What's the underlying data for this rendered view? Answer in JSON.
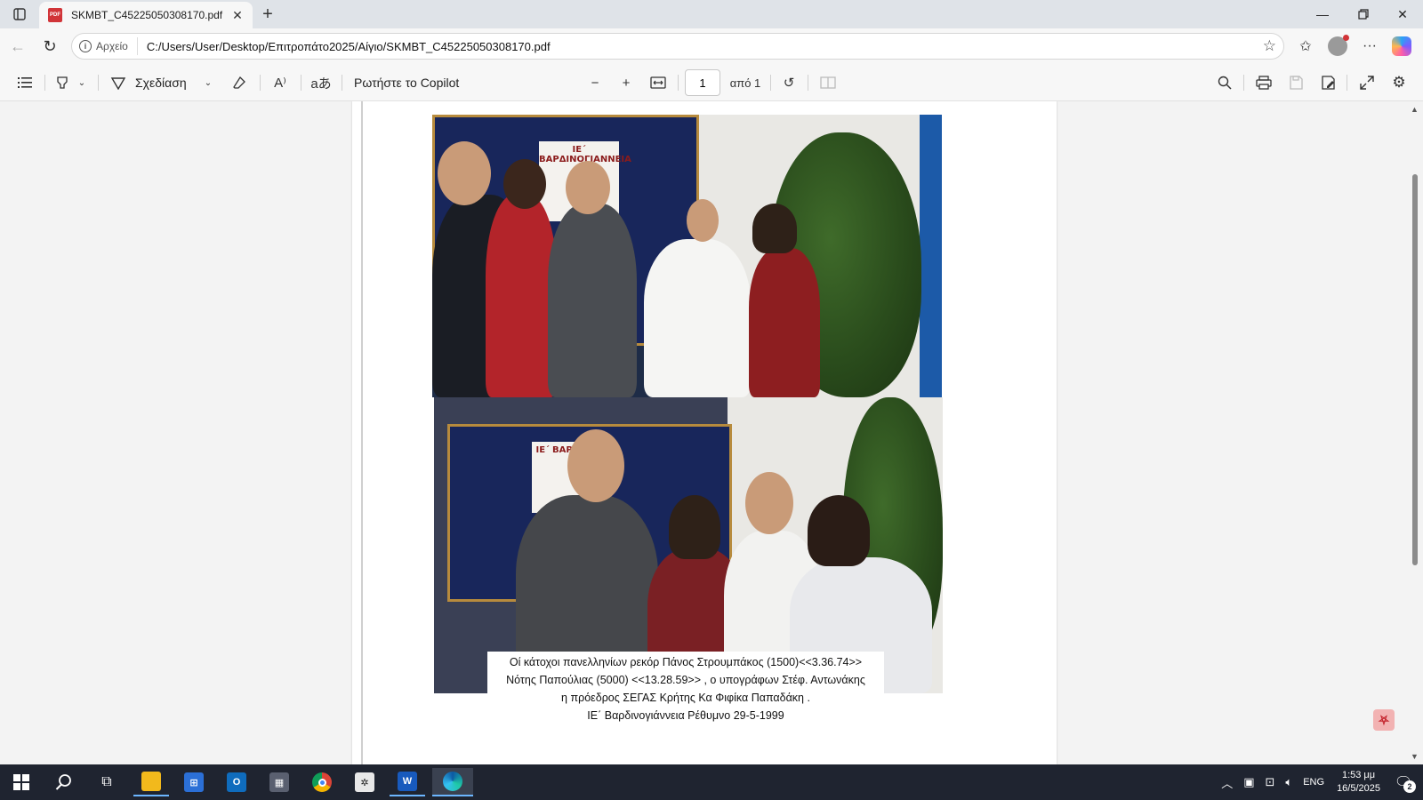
{
  "browser": {
    "tab_title": "SKMBT_C45225050308170.pdf",
    "tab_icon": "pdf-icon",
    "site_info_label": "Αρχείο",
    "url": "C:/Users/User/Desktop/Επιτροπάτο2025/Αίγιο/SKMBT_C45225050308170.pdf"
  },
  "pdf_toolbar": {
    "draw_label": "Σχεδίαση",
    "copilot_label": "Ρωτήστε το Copilot",
    "page_number": "1",
    "page_of_label": "από 1"
  },
  "document": {
    "sign_text_top": "ΙΕ΄ ΒΑΡΔΙΝΟΓΙΑΝΝΕΙΑ",
    "sign_text_bottom": "ΙΕ΄ ΒΑΡΔΙΝ",
    "caption_lines": [
      "Οί κάτοχοι πανελληνίων ρεκόρ Πάνος Στρουμπάκος (1500)<<3.36.74>>",
      "Νότης Παπούλιας (5000) <<13.28.59>> , ο υπογράφων Στέφ. Αντωνάκης",
      "η πρόεδρος ΣΕΓΑΣ Κρήτης  Κα Φιφίκα Παπαδάκη .",
      "ΙΕ΄ Βαρδινογιάννεια Ρέθυμνο 29-5-1999"
    ]
  },
  "taskbar": {
    "language": "ENG",
    "time": "1:53 μμ",
    "date": "16/5/2025",
    "notification_count": "2"
  },
  "colors": {
    "accent": "#6cb6ff",
    "pdf_red": "#d13438",
    "taskbar_bg": "#1f2430"
  }
}
